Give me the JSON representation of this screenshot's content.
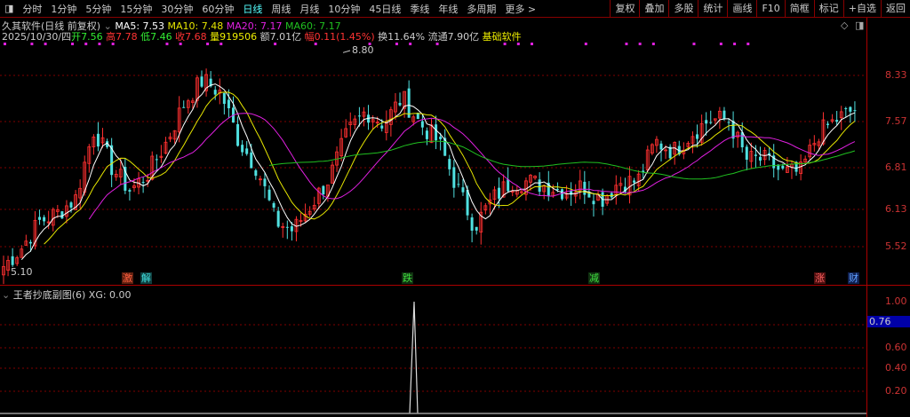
{
  "toolbar": {
    "periods": [
      "分时",
      "1分钟",
      "5分钟",
      "15分钟",
      "30分钟",
      "60分钟",
      "日线",
      "周线",
      "月线",
      "10分钟",
      "45日线",
      "季线",
      "年线",
      "多周期",
      "更多 >"
    ],
    "active": "日线",
    "buttons": [
      "复权",
      "叠加",
      "多股",
      "统计",
      "画线",
      "F10",
      "简框",
      "标记",
      "+自选",
      "返回"
    ]
  },
  "header": {
    "name": "久其软件(日线 前复权)",
    "ma5": "MA5: 7.53",
    "ma10": "MA10: 7.48",
    "ma20": "MA20: 7.17",
    "ma60": "MA60: 7.17",
    "date": "2025/10/30/四",
    "open": "开7.56",
    "high": "高7.78",
    "low": "低7.46",
    "close": "收7.68",
    "volume": "量919506",
    "amount": "额7.01亿",
    "change": "幅0.11(1.45%)",
    "turnover": "换11.64%",
    "float": "流通7.90亿",
    "sector": "基础软件"
  },
  "colors": {
    "ma5": "#ffffff",
    "ma10": "#e6e600",
    "ma20": "#e020e0",
    "ma60": "#20c020",
    "up": "#ff3030",
    "down": "#50e0e0",
    "grid": "#800000"
  },
  "price_axis": [
    "8.33",
    "7.57",
    "6.81",
    "6.13",
    "5.52"
  ],
  "max_label": "8.80",
  "min_label": "5.10",
  "tags": [
    {
      "text": "激",
      "color": "#ff6040",
      "bg": "#602010"
    },
    {
      "text": "解",
      "color": "#40e0e0",
      "bg": "#104040"
    },
    {
      "text": "跌",
      "color": "#40e040",
      "bg": "#103010"
    },
    {
      "text": "减",
      "color": "#40e040",
      "bg": "#103010"
    },
    {
      "text": "涨",
      "color": "#ff6060",
      "bg": "#501010"
    },
    {
      "text": "财",
      "color": "#60a0ff",
      "bg": "#102050"
    }
  ],
  "sub": {
    "title": "王者抄底副图(6) XG: 0.00",
    "axis": [
      "1.00",
      "0.60",
      "0.40",
      "0.20"
    ],
    "cursor_value": "0.76",
    "signal_level": 1.0
  },
  "chart_data": {
    "type": "candlestick",
    "closes": [
      5.26,
      5.5,
      5.86,
      5.98,
      6.2,
      7.33,
      6.66,
      6.31,
      6.59,
      7.1,
      7.81,
      8.24,
      7.98,
      7.1,
      6.66,
      5.86,
      5.73,
      6.11,
      6.51,
      7.25,
      7.65,
      7.41,
      7.9,
      7.41,
      7.1,
      6.38,
      5.79,
      6.18,
      6.45,
      6.45,
      6.38,
      6.31,
      6.38,
      6.18,
      6.45,
      6.45,
      7.1,
      6.94,
      7.25,
      7.49,
      7.49,
      6.8,
      6.8,
      6.59,
      6.59,
      7.25,
      7.49,
      7.68
    ],
    "high": 8.8,
    "low": 5.1
  }
}
